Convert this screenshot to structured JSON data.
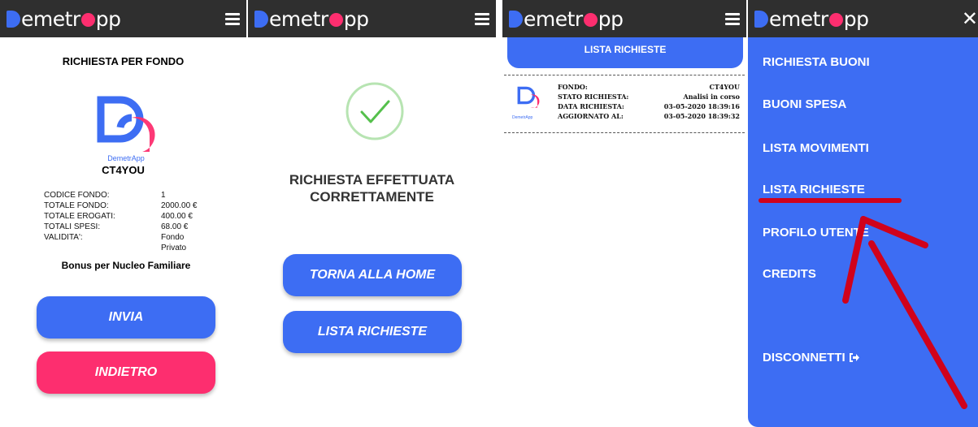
{
  "app": {
    "logo_text_a": "emetr",
    "logo_text_b": "pp"
  },
  "panel1": {
    "title": "RICHIESTA PER FONDO",
    "fund_logo_caption": "DemetrApp",
    "fund_name": "CT4YOU",
    "details": [
      {
        "label": "CODICE FONDO:",
        "value": "1"
      },
      {
        "label": "TOTALE FONDO:",
        "value": "2000.00 €"
      },
      {
        "label": "TOTALE EROGATI:",
        "value": "400.00 €"
      },
      {
        "label": "TOTALI SPESI:",
        "value": "68.00 €"
      },
      {
        "label": "VALIDITA':",
        "value": "Fondo Privato"
      }
    ],
    "bonus": "Bonus per Nucleo Familiare",
    "send_label": "INVIA",
    "back_label": "INDIETRO"
  },
  "panel2": {
    "success_line1": "RICHIESTA EFFETTUATA",
    "success_line2": "CORRETTAMENTE",
    "home_label": "TORNA ALLA HOME",
    "list_label": "LISTA RICHIESTE"
  },
  "panel3": {
    "header_label": "LISTA RICHIESTE",
    "logo_caption": "DemetrApp",
    "rows": [
      {
        "label": "FONDO:",
        "value": "CT4YOU"
      },
      {
        "label": "STATO RICHIESTA:",
        "value": "Analisi in corso"
      },
      {
        "label": "DATA RICHIESTA:",
        "value": "03-05-2020 18:39:16"
      },
      {
        "label": "AGGIORNATO AL:",
        "value": "03-05-2020 18:39:32"
      }
    ]
  },
  "panel4": {
    "menu": [
      "RICHIESTA BUONI",
      "BUONI SPESA",
      "LISTA MOVIMENTI",
      "LISTA RICHIESTE",
      "PROFILO UTENTE",
      "CREDITS"
    ],
    "logout_label": "DISCONNETTI",
    "close_glyph": "✕"
  },
  "colors": {
    "brand_blue": "#3d6df3",
    "brand_pink": "#fd2e6f",
    "topbar": "#2f2f2f",
    "success_green": "#7fd37a",
    "annotation_red": "#d0021b"
  }
}
